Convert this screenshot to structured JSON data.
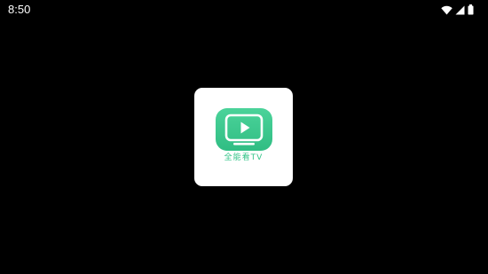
{
  "status_bar": {
    "time": "8:50",
    "icons": [
      "wifi-icon",
      "cellular-signal-icon",
      "battery-icon"
    ]
  },
  "splash": {
    "app_name": "全能看TV",
    "logo_icon": "tv-play-icon",
    "colors": {
      "background": "#000000",
      "card": "#ffffff",
      "brand_green": "#35c489"
    }
  }
}
